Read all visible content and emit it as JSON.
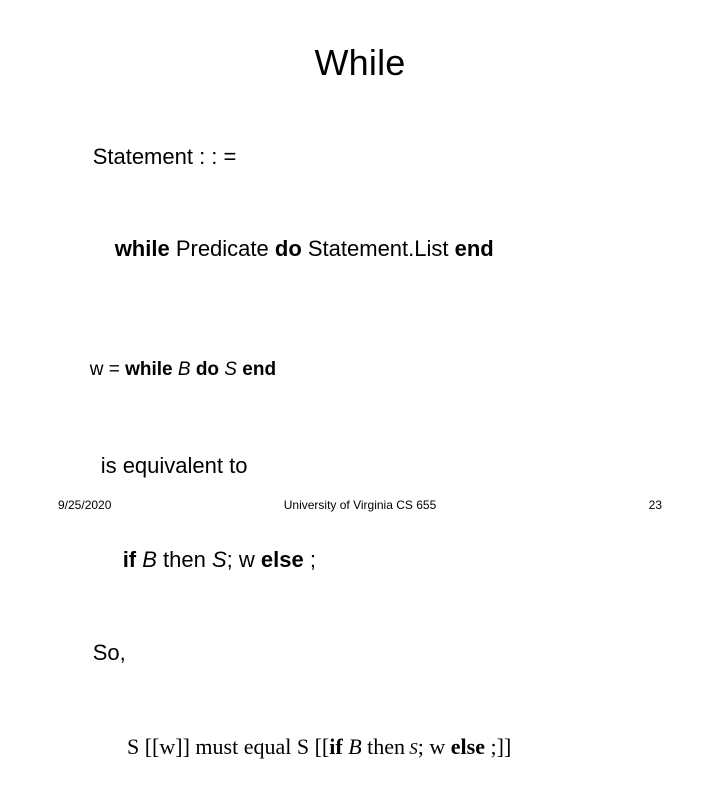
{
  "slide": {
    "title": "While",
    "lines": {
      "statement_head": "Statement : : =",
      "production": {
        "kw_while": "while",
        "predicate": " Predicate ",
        "kw_do": "do",
        "stmtlist": " Statement.List ",
        "kw_end": "end"
      },
      "w_def": {
        "prefix": "w = ",
        "kw_while": "while",
        "var_b": " B ",
        "kw_do": "do",
        "var_s": " S ",
        "kw_end": "end"
      },
      "equivalent": "is equivalent to",
      "if_line": {
        "kw_if": "if",
        "var_b": " B ",
        "kw_then": "then",
        "var_s": " S",
        "semi_w": "; w ",
        "kw_else": "else",
        "semi": " ;"
      },
      "so": "So,",
      "semantics": {
        "s1": "S [[w]] must equal S [[",
        "kw_if": "if",
        "var_b": " B ",
        "kw_then": "then",
        "var_s": " S",
        "semi_w": "; w ",
        "kw_else": "else",
        "tail": " ;]]"
      }
    }
  },
  "footer": {
    "date": "9/25/2020",
    "center": "University of Virginia CS 655",
    "page": "23"
  }
}
